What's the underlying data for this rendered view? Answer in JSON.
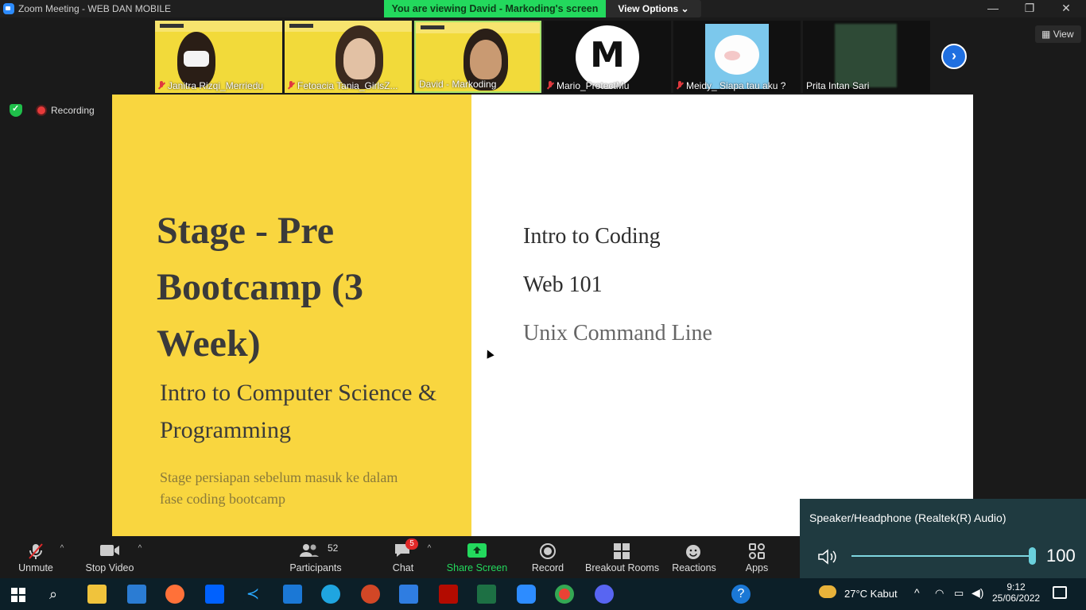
{
  "window": {
    "title": "Zoom Meeting - WEB DAN MOBILE"
  },
  "share_banner": {
    "viewing_text": "You are viewing David - Markoding's screen",
    "view_options_label": "View Options"
  },
  "view_label": "View",
  "participants_strip": [
    {
      "name": "Janitra Rizqi_Merriedu",
      "muted": true
    },
    {
      "name": "Fetoacia Tania_GirlsZ...",
      "muted": true
    },
    {
      "name": "David - Markoding",
      "muted": false
    },
    {
      "name": "Mario_ProtectMu",
      "muted": true
    },
    {
      "name": "Meidy_ Siapa tau aku ?",
      "muted": true
    },
    {
      "name": "Prita Intan Sari",
      "muted": false
    }
  ],
  "recording": {
    "label": "Recording"
  },
  "slide": {
    "title": "Stage - Pre Bootcamp (3 Week)",
    "subtitle": "Intro to Computer Science & Programming",
    "description": "Stage persiapan sebelum masuk ke dalam fase coding bootcamp",
    "topics": [
      "Intro to Coding",
      "Web 101",
      "Unix Command Line"
    ],
    "colors": {
      "left_panel": "#f9d63f",
      "right_panel": "#ffffff"
    }
  },
  "toolbar": {
    "unmute": "Unmute",
    "stop_video": "Stop Video",
    "participants": "Participants",
    "participants_count": "52",
    "chat": "Chat",
    "chat_badge": "5",
    "share_screen": "Share Screen",
    "record": "Record",
    "breakout_rooms": "Breakout Rooms",
    "reactions": "Reactions",
    "apps": "Apps"
  },
  "volume_popup": {
    "device": "Speaker/Headphone (Realtek(R) Audio)",
    "level": "100"
  },
  "taskbar": {
    "weather": "27°C  Kabut",
    "time": "9:12",
    "date": "25/06/2022"
  }
}
